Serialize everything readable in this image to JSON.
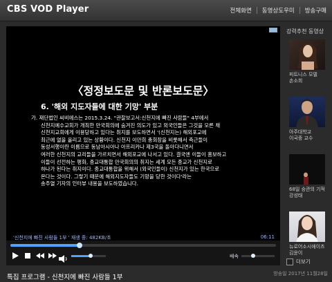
{
  "app": {
    "title": "CBS VOD Player"
  },
  "topnav": {
    "items": [
      "전체화면",
      "동영상도우미",
      "방송구매"
    ]
  },
  "video": {
    "heading": "〈정정보도문 및 반론보도문〉",
    "subheading": "6. '해외 지도자들에 대한 기망' 부분",
    "body_lines": [
      "가. 재단법인 씨비에스는 2015.3.24. \"관찰보고서:신천지에 빠진 사람들\" 4부에서",
      "신천지예수교회가 개최한 만국회의에 숨겨진 의도가 있고 외국인들은 그것을 모른 채",
      "신천지교회에게 이용당하고 있다는 취지를 보도하면서 '(신천지는) 해외포교에",
      "최근에 열을 올리고 있는 상황이다. 신천지 이만희 총회장을 비롯해서 측근들이",
      "동성서행이란 이름으로 동남아시아나 아프리카나 제3국을 돌아다니면서",
      "여러한 신천지의 교리들을 가르치면서 해외포교에 나서고 있다. 결국엔 이들이 홍보하고",
      "이들이 선전하는 평화, 종교대통합 만국회의의 취지는 세계 모든 종교가 신천지로",
      "하나가 된다는 취지이다. 종교대통합을 위해서 (외국인들이) 신천지가 있는 한국으로",
      "온다는 것이다. 그렇기 때문에 해외지도자들도 기망을 당한 것이다'라는",
      "송주열 기자의 인터뷰 내용을 보도하였습니다."
    ],
    "caption": "'신천지에 빠진 사람들 1부 ' 재생 중: 482KB/초",
    "timestamp": "06:11",
    "progress": 0.26,
    "volume": 0.55,
    "speed_label": "배속",
    "speed": 0.35
  },
  "controls": {
    "buttons": [
      "play-icon",
      "stop-icon",
      "rewind-icon",
      "forward-icon"
    ]
  },
  "footer": {
    "title": "특집 프로그램 - 신천지에 빠진 사람들 1부",
    "air_date": "방송일 2017년 11월28일"
  },
  "sidebar": {
    "title": "강력추천 동영상",
    "items": [
      {
        "line1": "피트니스 모델",
        "line2": "손소희"
      },
      {
        "line1": "아주대학교",
        "line2": "이국종 교수"
      },
      {
        "line1": "68일 승관의 기적",
        "line2": "강성태"
      },
      {
        "line1": "뉴로어소시에이츠",
        "line2": "김윤이"
      }
    ],
    "checkbox_label": "더보기"
  },
  "colors": {
    "accent": "#4fa3ff",
    "caption": "#9ab9ff"
  }
}
